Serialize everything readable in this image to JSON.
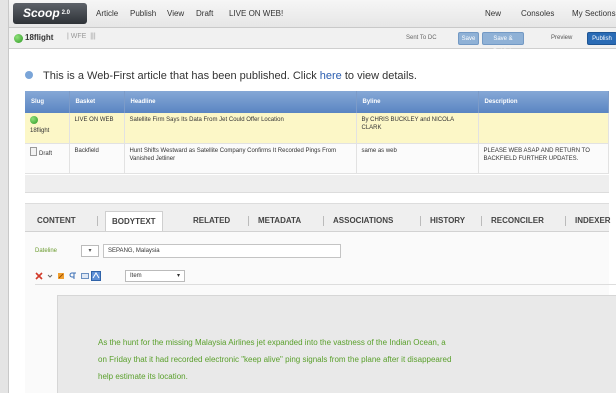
{
  "app": {
    "logo": "Scoop",
    "logo_sup": "2.0",
    "menu": [
      "Article",
      "Publish",
      "View",
      "Draft",
      "LIVE ON WEB!"
    ],
    "menu_right": [
      "New",
      "Consoles",
      "My Sections"
    ]
  },
  "toolbar": {
    "slug": "18flight",
    "slug_meta": "| WFE  |||",
    "sent_to": "Sent To DC",
    "buttons": [
      "Save",
      "Save & Publish"
    ],
    "preview_label": "Preview",
    "publish_label": "Publish"
  },
  "notice": {
    "text_before": "This is a Web-First article that has been published. Click ",
    "link": "here",
    "text_after": " to view details."
  },
  "table": {
    "headers": [
      "Slug",
      "Basket",
      "Headline",
      "Byline",
      "Description"
    ],
    "rows": [
      {
        "slug": "18flight",
        "basket": "LIVE ON WEB",
        "headline": "Satellite Firm Says Its Data From Jet Could Offer Location",
        "byline": "By CHRIS BUCKLEY and NICOLA CLARK",
        "description": ""
      },
      {
        "slug": "Draft",
        "basket": "Backfield",
        "headline": "Hunt Shifts Westward as Satellite Company Confirms It Recorded Pings From Vanished Jetliner",
        "byline": "same as web",
        "description": "PLEASE WEB ASAP AND RETURN TO BACKFIELD FURTHER UPDATES."
      }
    ]
  },
  "tabs": [
    "CONTENT",
    "BODYTEXT",
    "RELATED",
    "METADATA",
    "ASSOCIATIONS",
    "HISTORY",
    "RECONCILER",
    "INDEXER"
  ],
  "active_tab": "BODYTEXT",
  "dateline": {
    "label": "Dateline",
    "select": "▾",
    "value": "SEPANG, Malaysia"
  },
  "editor": {
    "style_select": "Item"
  },
  "body_lines": [
    "As the hunt for the missing Malaysia Airlines jet expanded into the vastness of the Indian Ocean, a",
    "on Friday that it had recorded electronic \"keep alive\" ping signals from the plane after it disappeared",
    "help estimate its location."
  ]
}
